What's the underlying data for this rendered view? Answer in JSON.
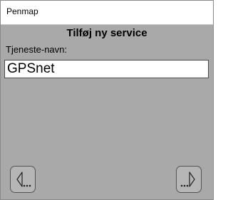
{
  "window": {
    "title": "Penmap"
  },
  "form": {
    "heading": "Tilføj ny service",
    "service_name_label": "Tjeneste-navn:",
    "service_name_value": "GPSnet"
  },
  "nav": {
    "prev_icon": "arrow-left-ellipsis-icon",
    "next_icon": "arrow-right-ellipsis-icon"
  }
}
